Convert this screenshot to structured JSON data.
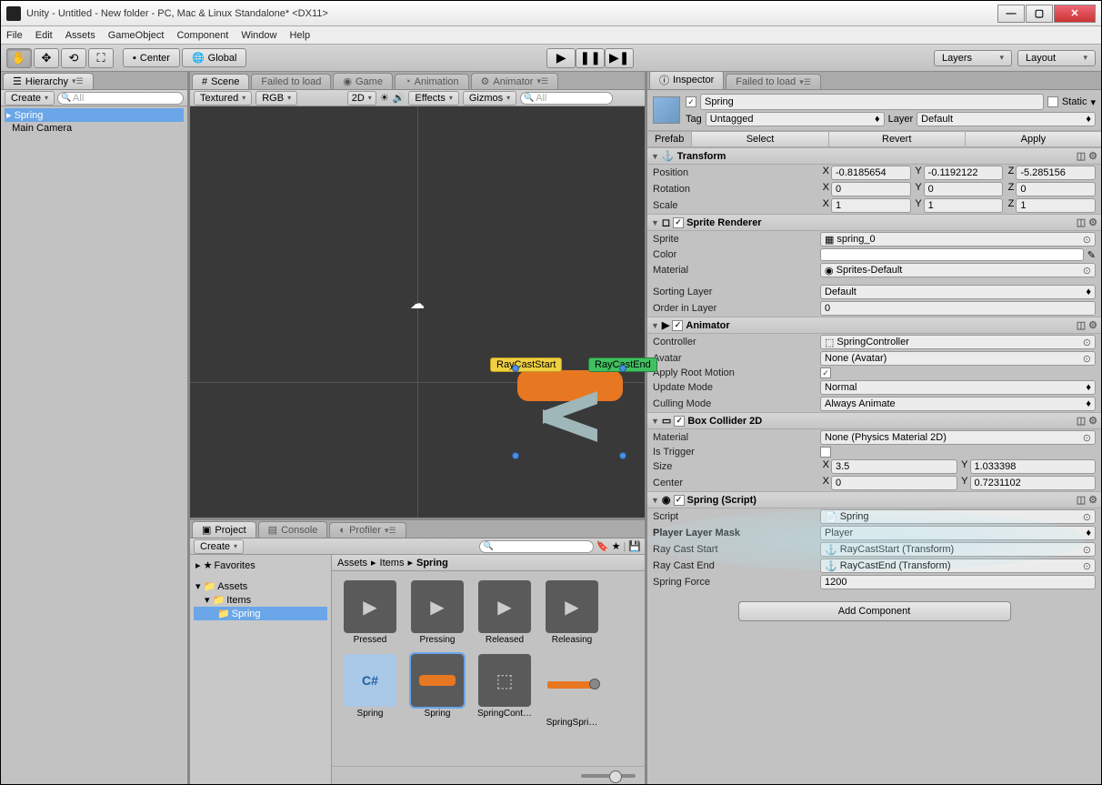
{
  "titlebar": {
    "title": "Unity - Untitled - New folder - PC, Mac & Linux Standalone* <DX11>"
  },
  "menu": [
    "File",
    "Edit",
    "Assets",
    "GameObject",
    "Component",
    "Window",
    "Help"
  ],
  "toolbar": {
    "pivot": "Center",
    "space": "Global",
    "layers": "Layers",
    "layout": "Layout"
  },
  "hierarchy": {
    "tab": "Hierarchy",
    "create": "Create",
    "search_placeholder": "All",
    "items": [
      {
        "name": "Spring",
        "selected": true
      },
      {
        "name": "Main Camera",
        "selected": false
      }
    ]
  },
  "scene": {
    "tabs": [
      "Scene",
      "Failed to load",
      "Game",
      "Animation",
      "Animator"
    ],
    "shading": "Textured",
    "rgb": "RGB",
    "mode2d": "2D",
    "effects": "Effects",
    "gizmos": "Gizmos",
    "search_placeholder": "All",
    "labels": {
      "start": "RayCastStart",
      "end": "RayCastEnd"
    }
  },
  "project": {
    "tabs": [
      "Project",
      "Console",
      "Profiler"
    ],
    "create": "Create",
    "favorites": "Favorites",
    "tree": [
      {
        "name": "Assets",
        "depth": 0
      },
      {
        "name": "Items",
        "depth": 1
      },
      {
        "name": "Spring",
        "depth": 2,
        "selected": true
      }
    ],
    "breadcrumb": [
      "Assets",
      "Items",
      "Spring"
    ],
    "assets": [
      {
        "name": "Pressed",
        "type": "anim"
      },
      {
        "name": "Pressing",
        "type": "anim"
      },
      {
        "name": "Released",
        "type": "anim"
      },
      {
        "name": "Releasing",
        "type": "anim"
      },
      {
        "name": "Spring",
        "type": "cs"
      },
      {
        "name": "Spring",
        "type": "sprite",
        "selected": true
      },
      {
        "name": "SpringCont…",
        "type": "controller"
      },
      {
        "name": "SpringSpri…",
        "type": "slider"
      }
    ]
  },
  "inspector": {
    "tab": "Inspector",
    "failed_tab": "Failed to load",
    "name": "Spring",
    "static_label": "Static",
    "tag_label": "Tag",
    "tag_value": "Untagged",
    "layer_label": "Layer",
    "layer_value": "Default",
    "prefab_label": "Prefab",
    "prefab_select": "Select",
    "prefab_revert": "Revert",
    "prefab_apply": "Apply",
    "transform": {
      "title": "Transform",
      "position_label": "Position",
      "position": {
        "x": "-0.8185654",
        "y": "-0.1192122",
        "z": "-5.285156"
      },
      "rotation_label": "Rotation",
      "rotation": {
        "x": "0",
        "y": "0",
        "z": "0"
      },
      "scale_label": "Scale",
      "scale": {
        "x": "1",
        "y": "1",
        "z": "1"
      }
    },
    "sprite_renderer": {
      "title": "Sprite Renderer",
      "sprite_label": "Sprite",
      "sprite": "spring_0",
      "color_label": "Color",
      "material_label": "Material",
      "material": "Sprites-Default",
      "sorting_label": "Sorting Layer",
      "sorting": "Default",
      "order_label": "Order in Layer",
      "order": "0"
    },
    "animator": {
      "title": "Animator",
      "controller_label": "Controller",
      "controller": "SpringController",
      "avatar_label": "Avatar",
      "avatar": "None (Avatar)",
      "root_label": "Apply Root Motion",
      "update_label": "Update Mode",
      "update": "Normal",
      "culling_label": "Culling Mode",
      "culling": "Always Animate"
    },
    "boxcollider": {
      "title": "Box Collider 2D",
      "material_label": "Material",
      "material": "None (Physics Material 2D)",
      "trigger_label": "Is Trigger",
      "size_label": "Size",
      "size_x": "3.5",
      "size_y": "1.033398",
      "center_label": "Center",
      "center_x": "0",
      "center_y": "0.7231102"
    },
    "spring_script": {
      "title": "Spring (Script)",
      "script_label": "Script",
      "script": "Spring",
      "mask_label": "Player Layer Mask",
      "mask": "Player",
      "start_label": "Ray Cast Start",
      "start": "RayCastStart (Transform)",
      "end_label": "Ray Cast End",
      "end": "RayCastEnd (Transform)",
      "force_label": "Spring Force",
      "force": "1200"
    },
    "add_component": "Add Component"
  }
}
